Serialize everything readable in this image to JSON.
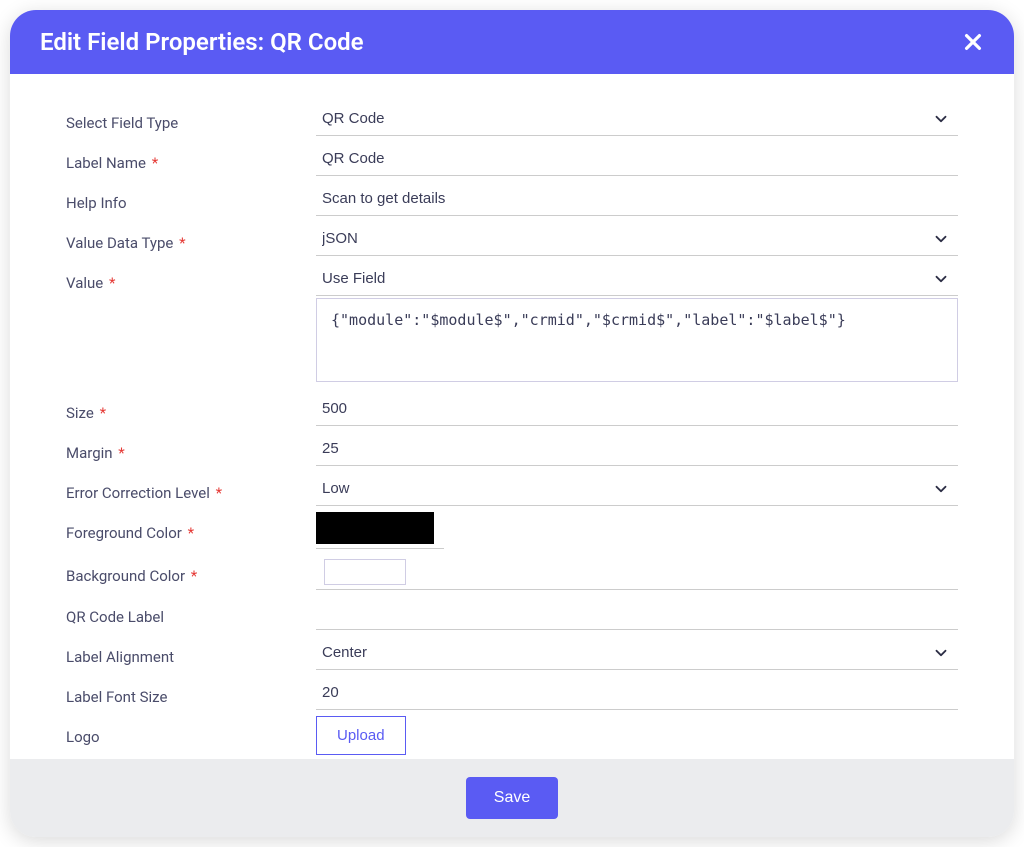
{
  "header": {
    "title": "Edit Field Properties: QR Code"
  },
  "labels": {
    "field_type": "Select Field Type",
    "label_name": "Label Name",
    "help_info": "Help Info",
    "value_data_type": "Value Data Type",
    "value": "Value",
    "size": "Size",
    "margin": "Margin",
    "ecl": "Error Correction Level",
    "fg_color": "Foreground Color",
    "bg_color": "Background Color",
    "qr_label": "QR Code Label",
    "label_align": "Label Alignment",
    "label_font_size": "Label Font Size",
    "logo": "Logo"
  },
  "values": {
    "field_type": "QR Code",
    "label_name": "QR Code",
    "help_info": "Scan to get details",
    "value_data_type": "jSON",
    "value_mode": "Use Field",
    "value_text": "{\"module\":\"$module$\",\"crmid\",\"$crmid$\",\"label\":\"$label$\"}",
    "size": "500",
    "margin": "25",
    "ecl": "Low",
    "fg_color": "#000000",
    "bg_color": "#ffffff",
    "qr_label": "",
    "label_align": "Center",
    "label_font_size": "20"
  },
  "buttons": {
    "upload": "Upload",
    "save": "Save"
  },
  "required_mark": "*"
}
